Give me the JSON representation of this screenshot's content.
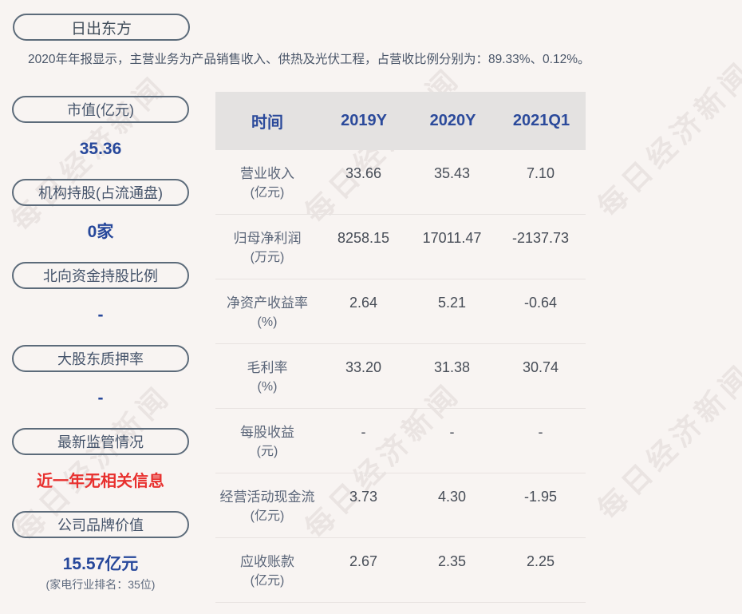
{
  "watermark": {
    "text": "每日经济新闻"
  },
  "header": {
    "company_name": "日出东方",
    "description": "2020年年报显示，主营业务为产品销售收入、供热及光伏工程，占营收比例分别为：89.33%、0.12%。"
  },
  "sidebar": {
    "items": [
      {
        "label": "市值(亿元)",
        "value": "35.36",
        "value_class": "blue"
      },
      {
        "label": "机构持股(占流通盘)",
        "value": "0家",
        "value_class": "blue"
      },
      {
        "label": "北向资金持股比例",
        "value": "-",
        "value_class": "blue"
      },
      {
        "label": "大股东质押率",
        "value": "-",
        "value_class": "blue"
      },
      {
        "label": "最新监管情况",
        "value": "近一年无相关信息",
        "value_class": "red"
      },
      {
        "label": "公司品牌价值",
        "value": "15.57亿元",
        "value_class": "blue",
        "sub_value": "(家电行业排名：35位)"
      }
    ]
  },
  "table": {
    "header": [
      "时间",
      "2019Y",
      "2020Y",
      "2021Q1"
    ],
    "rows": [
      {
        "name": "营业收入",
        "unit": "(亿元)",
        "values": [
          "33.66",
          "35.43",
          "7.10"
        ]
      },
      {
        "name": "归母净利润",
        "unit": "(万元)",
        "values": [
          "8258.15",
          "17011.47",
          "-2137.73"
        ]
      },
      {
        "name": "净资产收益率",
        "unit": "(%)",
        "values": [
          "2.64",
          "5.21",
          "-0.64"
        ]
      },
      {
        "name": "毛利率",
        "unit": "(%)",
        "values": [
          "33.20",
          "31.38",
          "30.74"
        ]
      },
      {
        "name": "每股收益",
        "unit": "(元)",
        "values": [
          "-",
          "-",
          "-"
        ]
      },
      {
        "name": "经营活动现金流",
        "unit": "(亿元)",
        "values": [
          "3.73",
          "4.30",
          "-1.95"
        ]
      },
      {
        "name": "应收账款",
        "unit": "(亿元)",
        "values": [
          "2.67",
          "2.35",
          "2.25"
        ]
      }
    ]
  },
  "colors": {
    "accent_blue": "#27489b",
    "alert_red": "#e8302e",
    "pill_border": "#5c6b7a",
    "table_header_bg": "#e4e2e1",
    "page_bg": "#f8f4f2"
  }
}
